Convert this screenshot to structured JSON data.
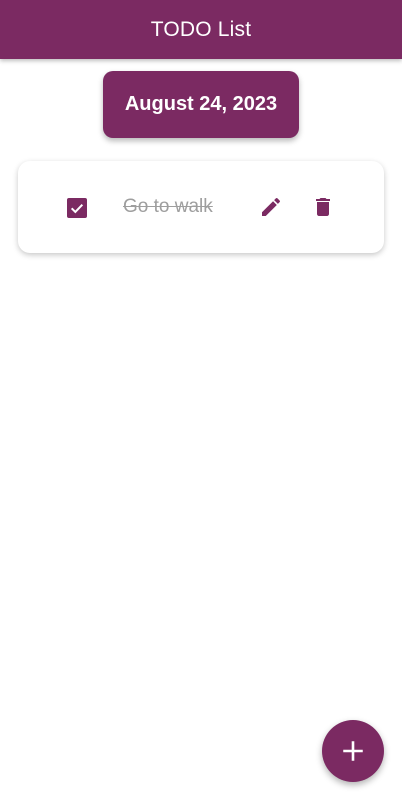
{
  "colors": {
    "primary": "#7b2a62",
    "background": "#ffffff",
    "completed_text": "#9e9e9e"
  },
  "appbar": {
    "title": "TODO List"
  },
  "date_chip": {
    "label": "August 24, 2023"
  },
  "todos": [
    {
      "text": "Go to walk",
      "completed": true,
      "check_icon": "check-box-icon",
      "edit_icon": "pencil-icon",
      "delete_icon": "trash-icon"
    }
  ],
  "fab": {
    "icon": "plus-icon"
  }
}
